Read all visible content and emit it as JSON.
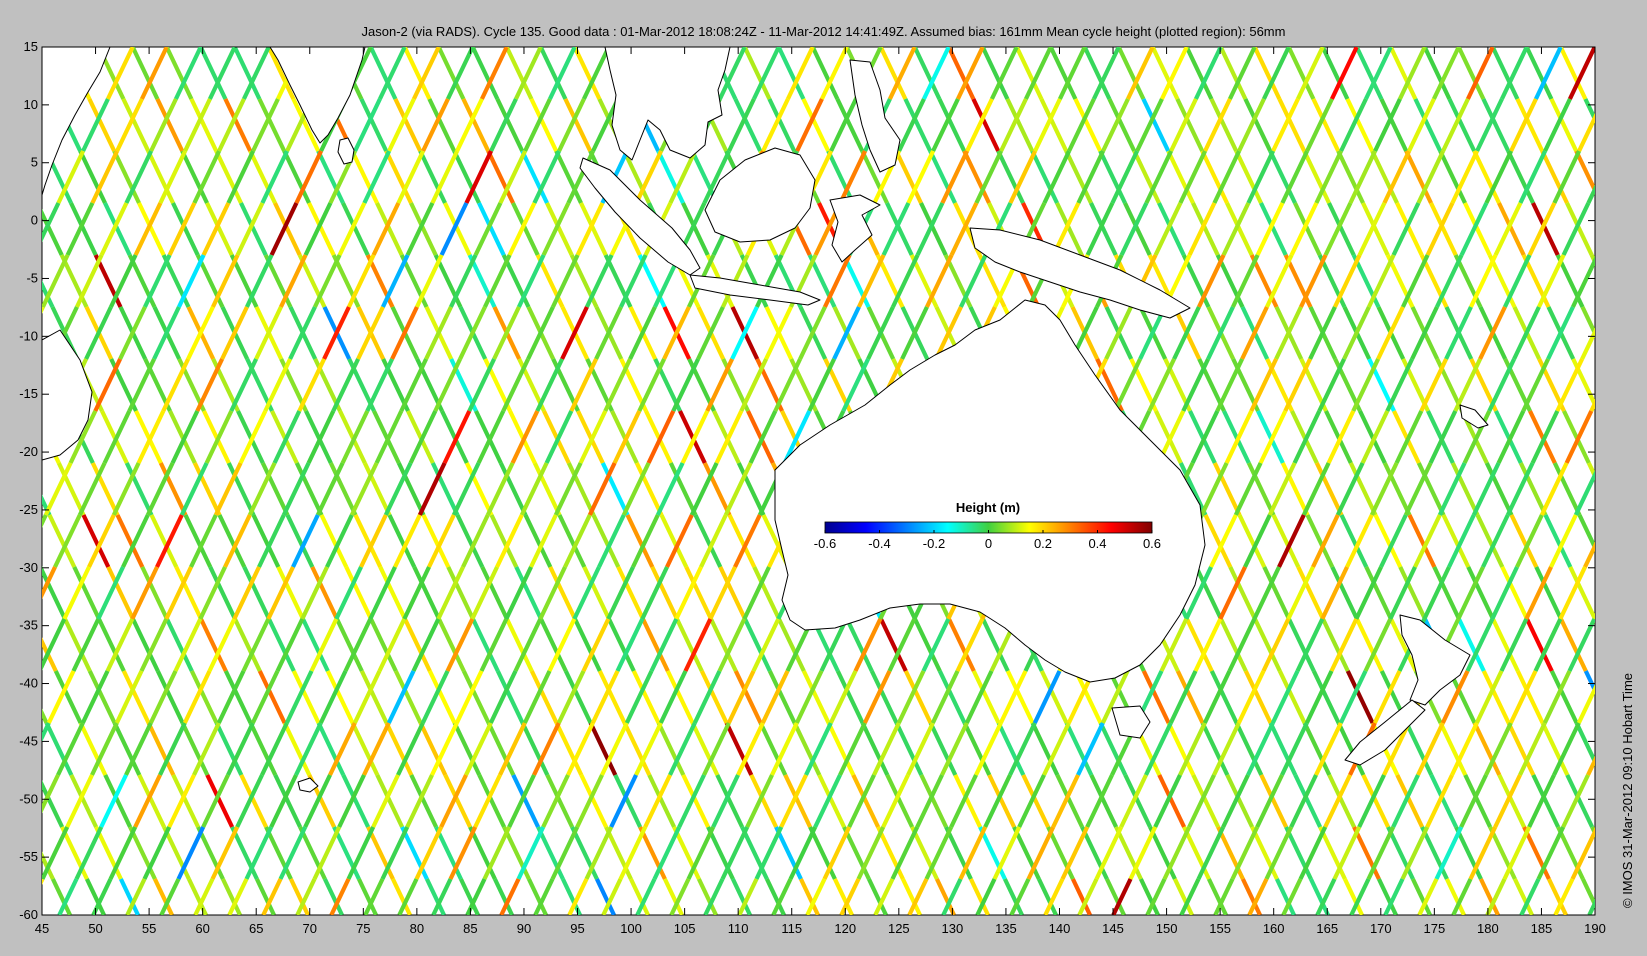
{
  "title": "Jason-2 (via RADS). Cycle 135. Good data : 01-Mar-2012 18:08:24Z - 11-Mar-2012 14:41:49Z. Assumed bias: 161mm  Mean cycle height (plotted region): 56mm",
  "credit": "© IMOS 31-Mar-2012 09:10 Hobart Time",
  "colors": {
    "figure_background": "#c0c0c0",
    "plot_background": "#ffffff",
    "coastline": "#000000"
  },
  "map": {
    "lon_range": [
      45,
      190
    ],
    "lat_range": [
      -60,
      15
    ],
    "x_ticks": [
      "45",
      "50",
      "55",
      "60",
      "65",
      "70",
      "75",
      "80",
      "85",
      "90",
      "95",
      "100",
      "105",
      "110",
      "115",
      "120",
      "125",
      "130",
      "135",
      "140",
      "145",
      "150",
      "155",
      "160",
      "165",
      "170",
      "175",
      "180",
      "185",
      "190"
    ],
    "y_ticks": [
      "15",
      "10",
      "5",
      "0",
      "-5",
      "-10",
      "-15",
      "-20",
      "-25",
      "-30",
      "-35",
      "-40",
      "-45",
      "-50",
      "-55",
      "-60"
    ],
    "colormap": "jet",
    "land_fill": "white",
    "data_type": "satellite altimeter sea surface height anomaly along ground tracks"
  },
  "colorbar": {
    "title": "Height (m)",
    "range": [
      -0.6,
      0.6
    ],
    "ticks": [
      "-0.6",
      "-0.4",
      "-0.2",
      "0",
      "0.2",
      "0.4",
      "0.6"
    ]
  }
}
